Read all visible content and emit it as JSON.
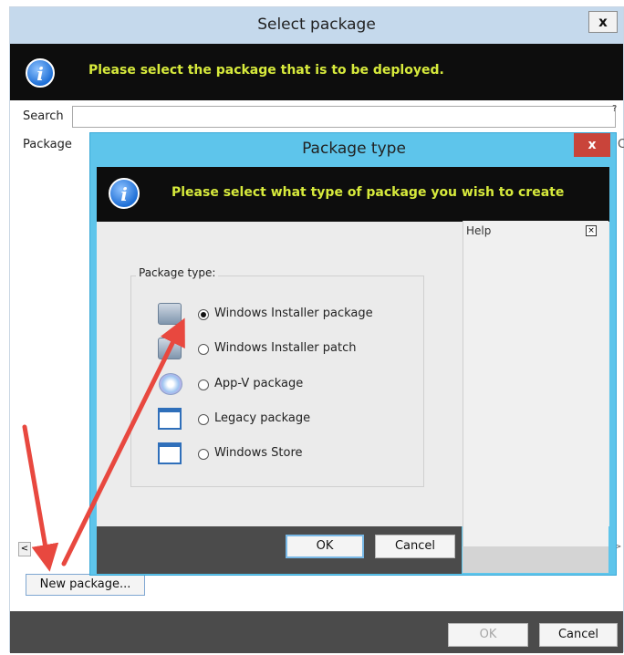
{
  "outer_dialog": {
    "title": "Select package",
    "close_glyph": "x",
    "banner_text": "Please select the package that is to be deployed.",
    "search_label": "Search",
    "search_value": "",
    "help_glyph": "?",
    "column_package": "Package",
    "column_edge_fragment": "C",
    "scroll_left_glyph": "<",
    "scroll_right_glyph": ">",
    "new_package_label": "New package...",
    "ok_label": "OK",
    "cancel_label": "Cancel"
  },
  "inner_dialog": {
    "title": "Package type",
    "close_glyph": "x",
    "banner_text": "Please select what type of package you wish to create",
    "group_label": "Package type:",
    "options": [
      {
        "label": "Windows Installer package",
        "icon": "installer-box-icon",
        "selected": true
      },
      {
        "label": "Windows Installer patch",
        "icon": "installer-patch-icon",
        "selected": false
      },
      {
        "label": "App-V package",
        "icon": "app-v-icon",
        "selected": false
      },
      {
        "label": "Legacy package",
        "icon": "window-icon",
        "selected": false
      },
      {
        "label": "Windows Store",
        "icon": "window-icon",
        "selected": false
      }
    ],
    "help_title": "Help",
    "help_close_glyph": "×",
    "ok_label": "OK",
    "cancel_label": "Cancel"
  },
  "info_glyph": "i",
  "colors": {
    "banner_bg": "#0d0d0d",
    "banner_text": "#d7ea3c",
    "inner_frame": "#5ec5eb",
    "outer_title_bar": "#c5d9ec",
    "close_button_red": "#c9443a",
    "annotation_arrow": "#e8483f"
  }
}
